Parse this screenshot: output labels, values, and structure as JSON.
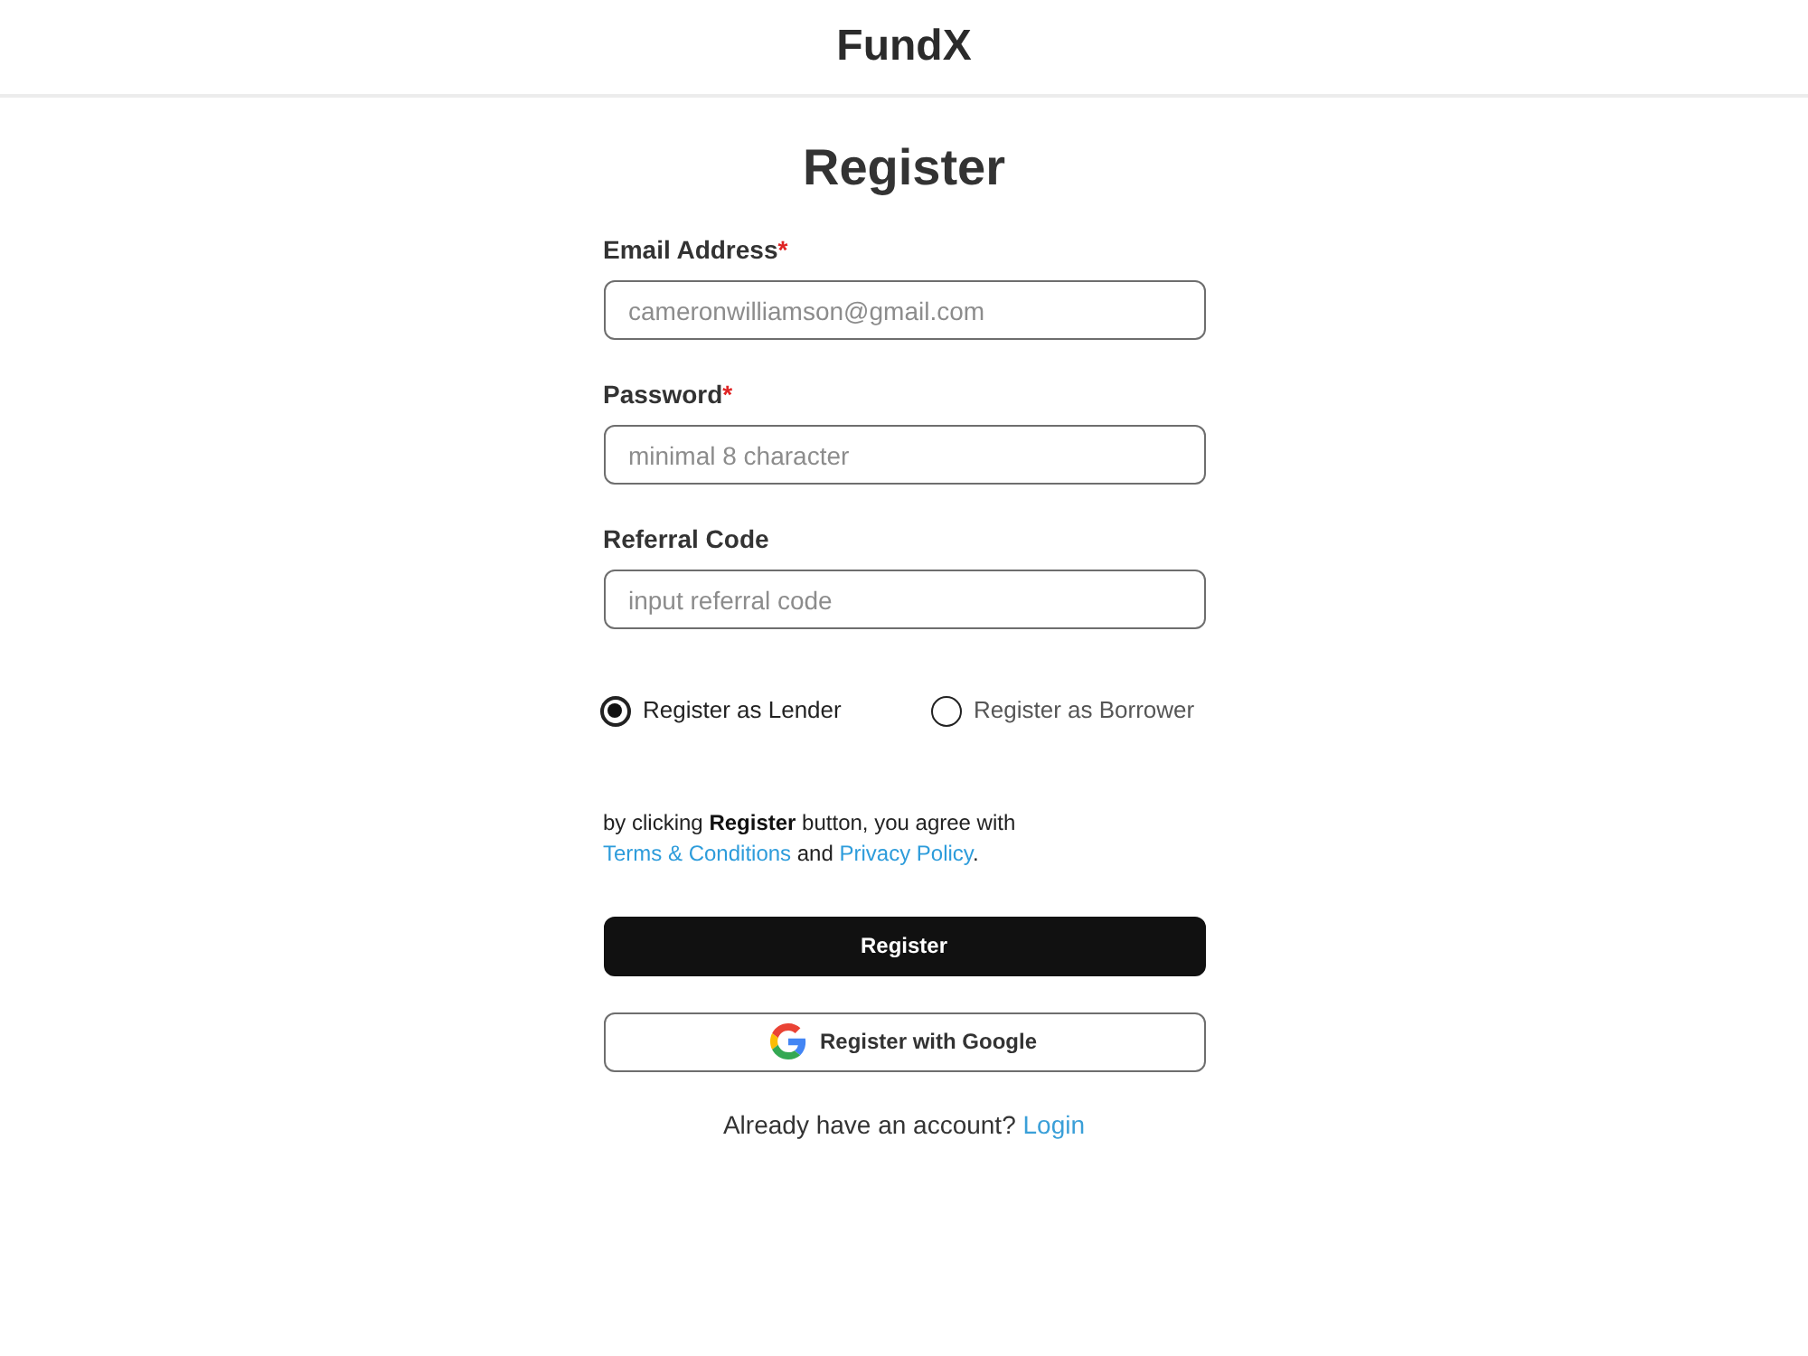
{
  "header": {
    "logo": "FundX"
  },
  "form": {
    "title": "Register",
    "fields": [
      {
        "label": "Email Address",
        "required_mark": "*",
        "placeholder": "cameronwilliamson@gmail.com"
      },
      {
        "label": "Password",
        "required_mark": "*",
        "placeholder": "minimal 8 character"
      },
      {
        "label": "Referral Code",
        "placeholder": "input referral code"
      }
    ],
    "roles": [
      {
        "label": "Register as Lender",
        "selected": true
      },
      {
        "label": "Register as Borrower",
        "selected": false
      }
    ],
    "terms": [
      {
        "kind": "text",
        "text": "by clicking **Register** button, you agree with "
      },
      {
        "kind": "link",
        "text": "Terms & Conditions"
      },
      {
        "kind": "text",
        "text": " and "
      },
      {
        "kind": "link",
        "text": "Privacy Policy"
      },
      {
        "kind": "text",
        "text": "."
      }
    ],
    "buttons": [
      {
        "kind": "primary",
        "label": "Register"
      },
      {
        "kind": "google",
        "label": "Register with Google"
      }
    ],
    "login_prompt": {
      "text": "Already have an account?",
      "link": "Login"
    }
  }
}
